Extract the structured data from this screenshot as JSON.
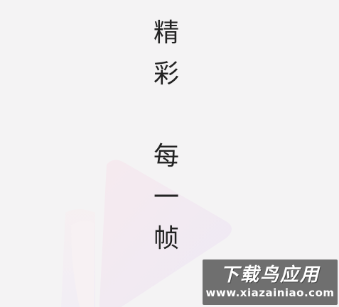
{
  "slogan": {
    "chars": [
      "精",
      "彩",
      "每",
      "一",
      "帧"
    ]
  },
  "watermark": {
    "title": "下载鸟应用",
    "url": "www.xiazainiao.com"
  },
  "colors": {
    "background": "#f4f3f4",
    "text": "#222222",
    "logo_pink": "#f3e6ec",
    "logo_lavender": "#ece9f6"
  },
  "icons": {
    "background_logo": "play-triangle-logo"
  }
}
